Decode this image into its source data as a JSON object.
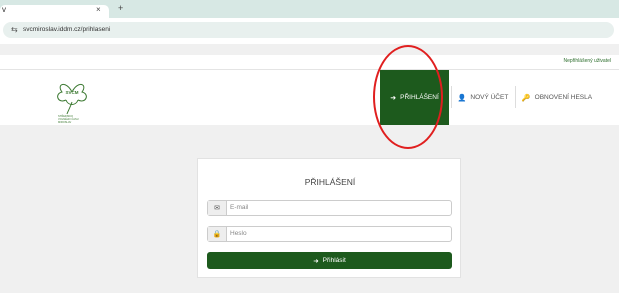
{
  "browser": {
    "tab_title": "v",
    "tab_close_glyph": "×",
    "new_tab_glyph": "+",
    "url": "svcmiroslav.iddm.cz/prihlaseni",
    "site_icon": "tune-icon"
  },
  "userbar": {
    "status": "Nepřihlášený uživatel"
  },
  "logo": {
    "letters": "SVČM",
    "lines": [
      "STŘEDISKO",
      "VOLNÉHO ČASU",
      "MIROSLAV"
    ],
    "color": "#3d7a33"
  },
  "nav": {
    "login": {
      "label": "PŘIHLÁŠENÍ",
      "icon": "sign-in-icon"
    },
    "register": {
      "label": "NOVÝ ÚČET",
      "icon": "user-plus-icon"
    },
    "reset": {
      "label": "OBNOVENÍ HESLA",
      "icon": "key-icon"
    }
  },
  "form": {
    "title": "PŘIHLÁŠENÍ",
    "email_placeholder": "E-mail",
    "email_value": "",
    "email_icon": "envelope-icon",
    "password_placeholder": "Heslo",
    "password_value": "",
    "password_icon": "lock-icon",
    "submit_label": "Přihlásit",
    "submit_icon": "sign-in-icon"
  },
  "colors": {
    "brand": "#1d5a1d",
    "annotation": "#e01f1f",
    "background": "#f0f0f0"
  }
}
